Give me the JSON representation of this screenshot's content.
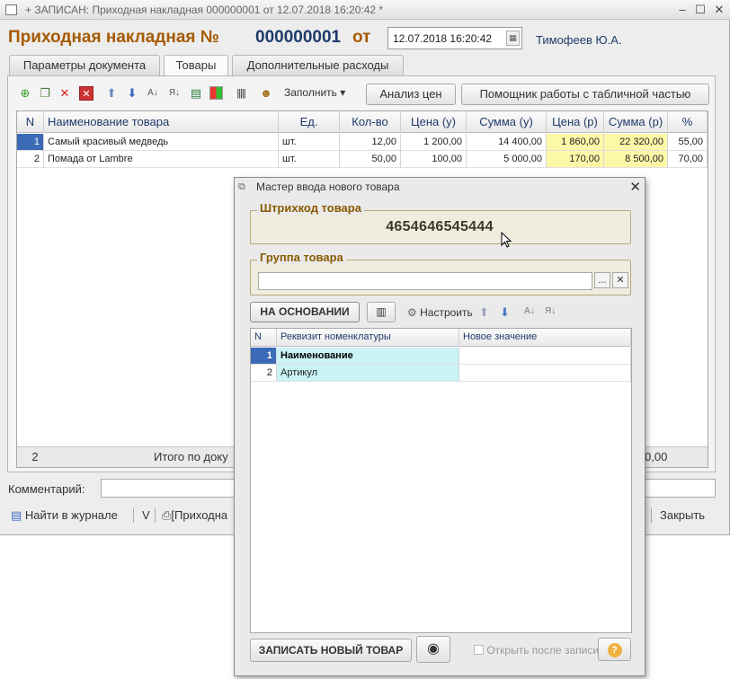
{
  "window": {
    "title": "+ ЗАПИСАН: Приходная накладная 000000001 от 12.07.2018 16:20:42 *",
    "controls": [
      "–",
      "☐",
      "✕"
    ]
  },
  "header": {
    "doc_title": "Приходная накладная №",
    "doc_number": "000000001",
    "from_label": "от",
    "date": "12.07.2018 16:20:42",
    "author": "Тимофеев Ю.А."
  },
  "tabs": [
    {
      "label": "Параметры документа"
    },
    {
      "label": "Товары"
    },
    {
      "label": "Дополнительные расходы"
    }
  ],
  "toolbar": {
    "fill_label": "Заполнить",
    "price_analysis": "Анализ цен",
    "table_helper": "Помощник работы с табличной частью"
  },
  "table": {
    "columns": [
      "N",
      "Наименование товара",
      "Ед.",
      "Кол-во",
      "Цена (у)",
      "Сумма (у)",
      "Цена (р)",
      "Сумма (р)",
      "%"
    ],
    "rows": [
      {
        "n": "1",
        "name": "Самый красивый медведь",
        "unit": "шт.",
        "qty": "12,00",
        "price_u": "1 200,00",
        "sum_u": "14 400,00",
        "price_r": "1 860,00",
        "sum_r": "22 320,00",
        "pct": "55,00"
      },
      {
        "n": "2",
        "name": "Помада от Lambre",
        "unit": "шт.",
        "qty": "50,00",
        "price_u": "100,00",
        "sum_u": "5 000,00",
        "price_r": "170,00",
        "sum_r": "8 500,00",
        "pct": "70,00"
      }
    ],
    "footer_count": "2",
    "footer_label": "Итого по доку",
    "footer_sum": "0,00"
  },
  "comment_label": "Комментарий:",
  "bottom": {
    "journal": "Найти в журнале",
    "v": "V",
    "print": "[Приходна",
    "close": "Закрыть"
  },
  "dialog": {
    "title": "Мастер ввода нового товара",
    "barcode_title": "Штрихкод товара",
    "barcode_value": "4654646545444",
    "group_title": "Группа товара",
    "group_value": "",
    "based_on": "НА ОСНОВАНИИ",
    "configure": "Настроить",
    "grid_columns": [
      "N",
      "Реквизит номенклатуры",
      "Новое значение"
    ],
    "grid_rows": [
      {
        "n": "1",
        "attr": "Наименование",
        "value": ""
      },
      {
        "n": "2",
        "attr": "Артикул",
        "value": ""
      }
    ],
    "save_button": "ЗАПИСАТЬ НОВЫЙ ТОВАР",
    "open_after": "Открыть после записи",
    "help": "?"
  }
}
